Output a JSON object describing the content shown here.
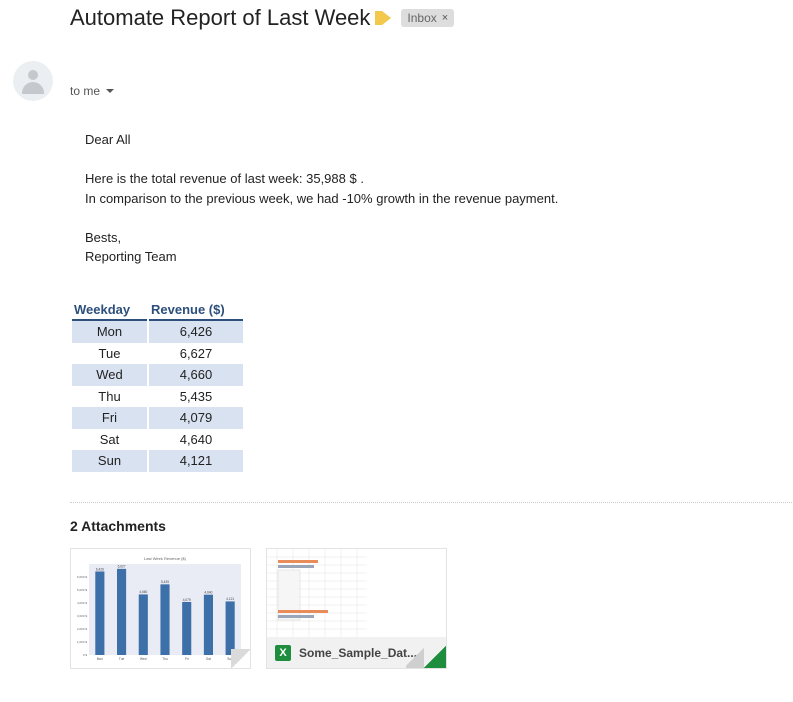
{
  "subject": "Automate Report of Last Week",
  "label": {
    "text": "Inbox",
    "close": "×"
  },
  "recipient": "to me",
  "body": {
    "greeting": "Dear All",
    "line1": "Here is the total revenue of last week:   35,988 $ .",
    "line2": "In comparison to the previous week, we had -10% growth in the revenue payment.",
    "signoff": "Bests,",
    "signature": "Reporting Team"
  },
  "table": {
    "headers": [
      "Weekday",
      "Revenue ($)"
    ],
    "rows": [
      [
        "Mon",
        "6,426"
      ],
      [
        "Tue",
        "6,627"
      ],
      [
        "Wed",
        "4,660"
      ],
      [
        "Thu",
        "5,435"
      ],
      [
        "Fri",
        "4,079"
      ],
      [
        "Sat",
        "4,640"
      ],
      [
        "Sun",
        "4,121"
      ]
    ]
  },
  "attachments": {
    "title": "2 Attachments",
    "items": [
      {
        "type": "image-chart"
      },
      {
        "type": "xlsx",
        "name": "Some_Sample_Dat...",
        "icon": "X"
      }
    ]
  },
  "chart_data": {
    "type": "bar",
    "title": "Last Week Revenue ($)",
    "categories": [
      "Mon",
      "Tue",
      "Wed",
      "Thu",
      "Fri",
      "Sat",
      "Sun"
    ],
    "values": [
      6426,
      6627,
      4660,
      5435,
      4079,
      4640,
      4121
    ],
    "data_labels": [
      "6,426",
      "6,627",
      "4,660",
      "5,435",
      "4,079",
      "4,640",
      "4,121"
    ],
    "ylim": [
      0,
      7000
    ],
    "yticks": [
      "0 $",
      "1,000 $",
      "2,000 $",
      "3,000 $",
      "4,000 $",
      "5,000 $",
      "6,000 $"
    ],
    "colors": {
      "bar": "#3d6fa8",
      "plot_bg": "#e9ecf5"
    }
  },
  "colors": {
    "accent": "#2c4f7c",
    "row_shade": "#d9e2f0",
    "importance": "#f2c94c",
    "excel_green": "#1e8e3e"
  }
}
